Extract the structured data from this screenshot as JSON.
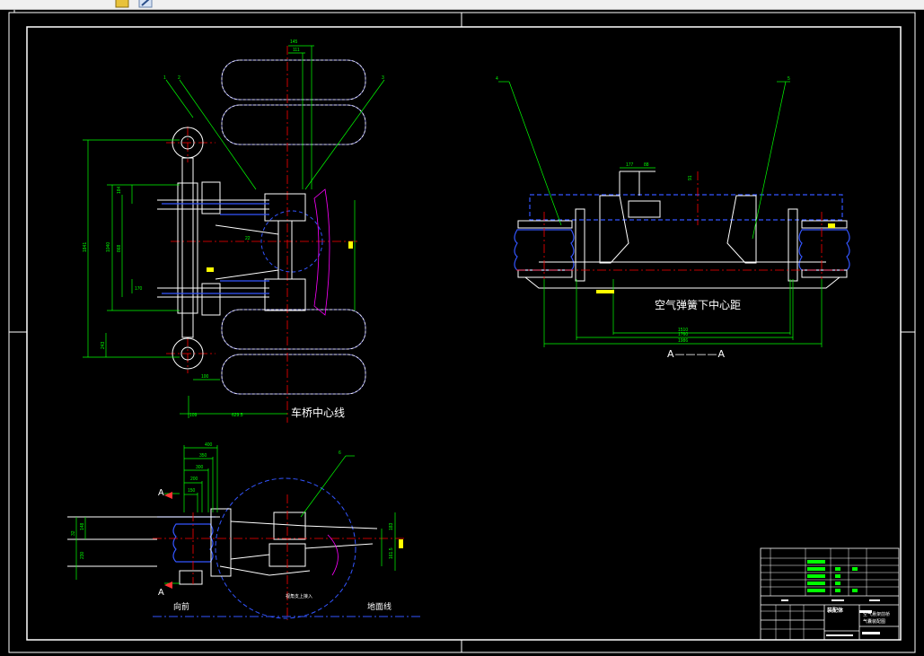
{
  "toolbar": {
    "icons": [
      "open-file-icon",
      "edit-icon"
    ]
  },
  "drawing": {
    "label_axle_centerline": "车桥中心线",
    "label_air_spring_center": "空气弹簧下中心距",
    "label_section": "A————A",
    "label_front": "向前",
    "label_ground": "地面线",
    "label_note": "视角支上接入",
    "section_mark": "A",
    "part_numbers": [
      "1",
      "2",
      "3",
      "4",
      "5",
      "6"
    ],
    "dims_top": [
      "145",
      "111"
    ],
    "dims_left": [
      "1841",
      "1040",
      "868",
      "184",
      "170",
      "243"
    ],
    "dims_bottom": [
      "100",
      "109",
      "629.5"
    ],
    "dims_section": [
      "177",
      "88",
      "91",
      "1510",
      "1760",
      "1986"
    ],
    "dims_side_top": [
      "400",
      "350",
      "300",
      "200",
      "150"
    ],
    "dims_side_left": [
      "32",
      "148",
      "230"
    ],
    "dims_side_right": [
      "183",
      "161.5"
    ],
    "inner_dim": "22"
  },
  "title_block": {
    "name": "装配体",
    "design_line1": "空气悬架前桥",
    "design_line2": "气囊装配图"
  },
  "colors": {
    "background": "#000000",
    "frame": "#ffffff",
    "dimension": "#00ff00",
    "center_line": "#ff0000",
    "leader": "#00ff00",
    "blue_part": "#3355ff",
    "magenta": "#ff00ff",
    "yellow": "#ffff00"
  }
}
